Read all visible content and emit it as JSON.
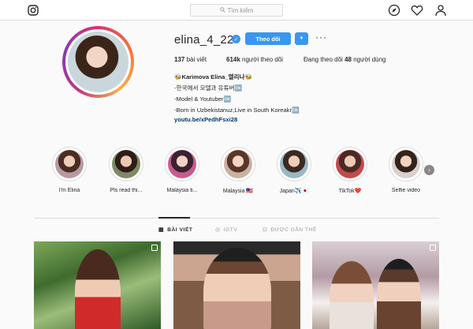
{
  "app": {
    "name": "Instagram"
  },
  "topbar": {
    "search_placeholder": "Tìm kiếm",
    "icons": [
      "instagram-logo-icon",
      "search-icon",
      "explore-compass-icon",
      "heart-icon",
      "user-icon"
    ]
  },
  "profile": {
    "username": "elina_4_22",
    "verified": true,
    "follow_label": "Theo dõi",
    "more_label": "···",
    "stats": {
      "posts_count": "137",
      "posts_label": "bài viết",
      "followers_count": "614k",
      "followers_label": "người theo dõi",
      "following_prefix": "Đang theo dõi",
      "following_count": "48",
      "following_label": "người dùng"
    },
    "bio": {
      "name_line": "🐝Karimova Elina_엘리나🐝",
      "line1": "-한국에서 모델과 유튜버🆗",
      "line2": "-Model & Youtuber🆗",
      "line3": "-Born in Uzbekistanuz,Live in South Koreakr🆗",
      "link": "youtu.be/xPedhFsxi28"
    }
  },
  "highlights": [
    {
      "label": "I'm Elina"
    },
    {
      "label": "Pls read thi..."
    },
    {
      "label": "Malaysia ti..."
    },
    {
      "label": "Malaysia 🇲🇾"
    },
    {
      "label": "Japan✈️🇯🇵"
    },
    {
      "label": "TikTok❤️"
    },
    {
      "label": "Selfie video"
    }
  ],
  "tabs": [
    {
      "label": "BÀI VIẾT",
      "active": true
    },
    {
      "label": "IGTV",
      "active": false
    },
    {
      "label": "ĐƯỢC GẮN THẺ",
      "active": false
    }
  ],
  "colors": {
    "accent": "#3897f0",
    "background": "#fafafa",
    "border": "#dbdbdb",
    "link": "#003569"
  }
}
